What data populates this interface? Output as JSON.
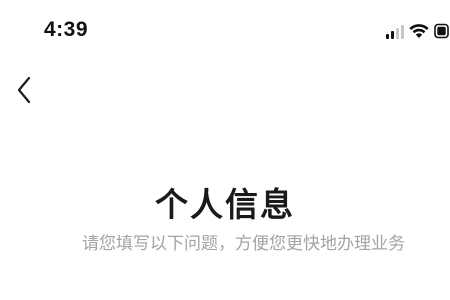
{
  "status_bar": {
    "time": "4:39",
    "icons": [
      "signal-icon",
      "wifi-icon",
      "battery-icon"
    ]
  },
  "nav": {
    "back_icon": "chevron-left-icon"
  },
  "main": {
    "title": "个人信息",
    "subtitle": "请您填写以下问题，方便您更快地办理业务"
  },
  "colors": {
    "background": "#ffffff",
    "title": "#1a1a1a",
    "subtitle": "#a3a3a8",
    "status_text": "#111111"
  }
}
